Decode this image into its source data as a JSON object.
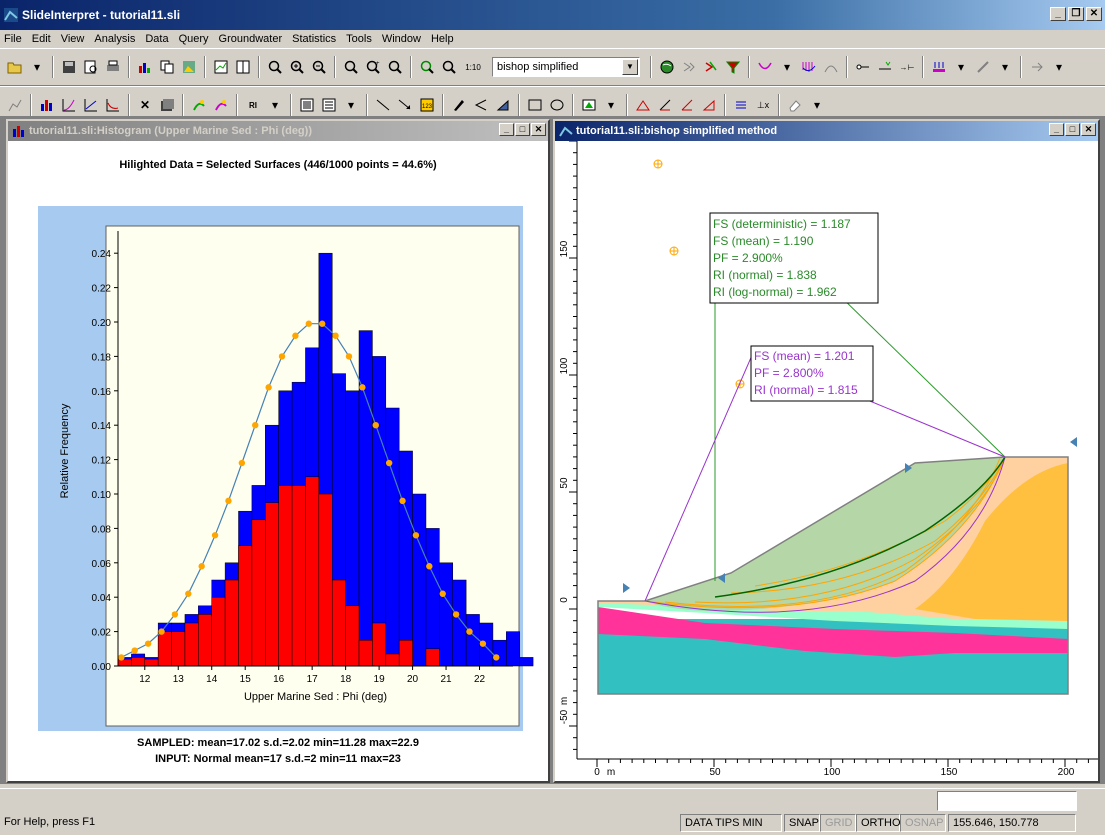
{
  "app": {
    "title": "SlideInterpret - tutorial11.sli",
    "min": "_",
    "max": "❐",
    "close": "✕"
  },
  "menu": [
    "File",
    "Edit",
    "View",
    "Analysis",
    "Data",
    "Query",
    "Groundwater",
    "Statistics",
    "Tools",
    "Window",
    "Help"
  ],
  "toolbar": {
    "analysis_method": "bishop simplified"
  },
  "histogram_window": {
    "title": "tutorial11.sli:Histogram (Upper Marine Sed : Phi (deg))",
    "header": "Hilighted Data = Selected Surfaces   (446/1000 points = 44.6%)",
    "footer_sampled": "SAMPLED: mean=17.02 s.d.=2.02 min=11.28 max=22.9",
    "footer_input": "INPUT: Normal mean=17 s.d.=2 min=11 max=23"
  },
  "model_window": {
    "title": "tutorial11.sli:bishop simplified method",
    "box_green": [
      "FS (deterministic) = 1.187",
      "FS (mean) = 1.190",
      "PF = 2.900%",
      "RI (normal) = 1.838",
      "RI (log-normal) = 1.962"
    ],
    "box_purple": [
      "FS (mean) = 1.201",
      "PF = 2.800%",
      "RI (normal) = 1.815"
    ],
    "y_ticks": [
      "150",
      "100",
      "50",
      "0",
      "-50"
    ],
    "y_unit": "m",
    "x_ticks": [
      "0",
      "50",
      "100",
      "150",
      "200"
    ],
    "x_unit": "m"
  },
  "chart_data": {
    "type": "bar",
    "xlabel": "Upper Marine Sed : Phi (deg)",
    "ylabel": "Relative Frequency",
    "xlim": [
      11.2,
      23.0
    ],
    "ylim": [
      0,
      0.25
    ],
    "x_ticks": [
      12,
      13,
      14,
      15,
      16,
      17,
      18,
      19,
      20,
      21,
      22
    ],
    "y_ticks": [
      0.0,
      0.02,
      0.04,
      0.06,
      0.08,
      0.1,
      0.12,
      0.14,
      0.16,
      0.18,
      0.2,
      0.22,
      0.24
    ],
    "bin_start": 11.2,
    "bin_width": 0.4,
    "series": [
      {
        "color": "#0000ff",
        "values": [
          0.005,
          0.007,
          0.005,
          0.025,
          0.025,
          0.03,
          0.035,
          0.05,
          0.06,
          0.09,
          0.105,
          0.14,
          0.16,
          0.165,
          0.185,
          0.24,
          0.17,
          0.16,
          0.195,
          0.18,
          0.15,
          0.125,
          0.1,
          0.08,
          0.06,
          0.05,
          0.03,
          0.025,
          0.015,
          0.02,
          0.005
        ]
      },
      {
        "color": "#ff0000",
        "values": [
          0.004,
          0.005,
          0.004,
          0.02,
          0.02,
          0.025,
          0.03,
          0.04,
          0.05,
          0.07,
          0.085,
          0.095,
          0.105,
          0.105,
          0.11,
          0.1,
          0.05,
          0.035,
          0.015,
          0.025,
          0.007,
          0.015,
          0.0,
          0.01,
          0.0,
          0.0,
          0.0,
          0.0,
          0.0,
          0.0,
          0.0
        ]
      }
    ],
    "input_curve": {
      "color": "#4682b4",
      "marker_color": "#ffa500",
      "x": [
        11.3,
        11.7,
        12.1,
        12.5,
        12.9,
        13.3,
        13.7,
        14.1,
        14.5,
        14.9,
        15.3,
        15.7,
        16.1,
        16.5,
        16.9,
        17.3,
        17.7,
        18.1,
        18.5,
        18.9,
        19.3,
        19.7,
        20.1,
        20.5,
        20.9,
        21.3,
        21.7,
        22.1,
        22.5
      ],
      "y": [
        0.005,
        0.009,
        0.013,
        0.02,
        0.03,
        0.042,
        0.058,
        0.076,
        0.096,
        0.118,
        0.14,
        0.162,
        0.18,
        0.192,
        0.199,
        0.199,
        0.192,
        0.18,
        0.162,
        0.14,
        0.118,
        0.096,
        0.076,
        0.058,
        0.042,
        0.03,
        0.02,
        0.013,
        0.005
      ]
    }
  },
  "status": {
    "help": "For Help, press F1",
    "data_tips": "DATA TIPS MIN",
    "snap": "SNAP",
    "grid": "GRID",
    "ortho": "ORTHO",
    "osnap": "OSNAP",
    "coords": "155.646,  150.778"
  }
}
